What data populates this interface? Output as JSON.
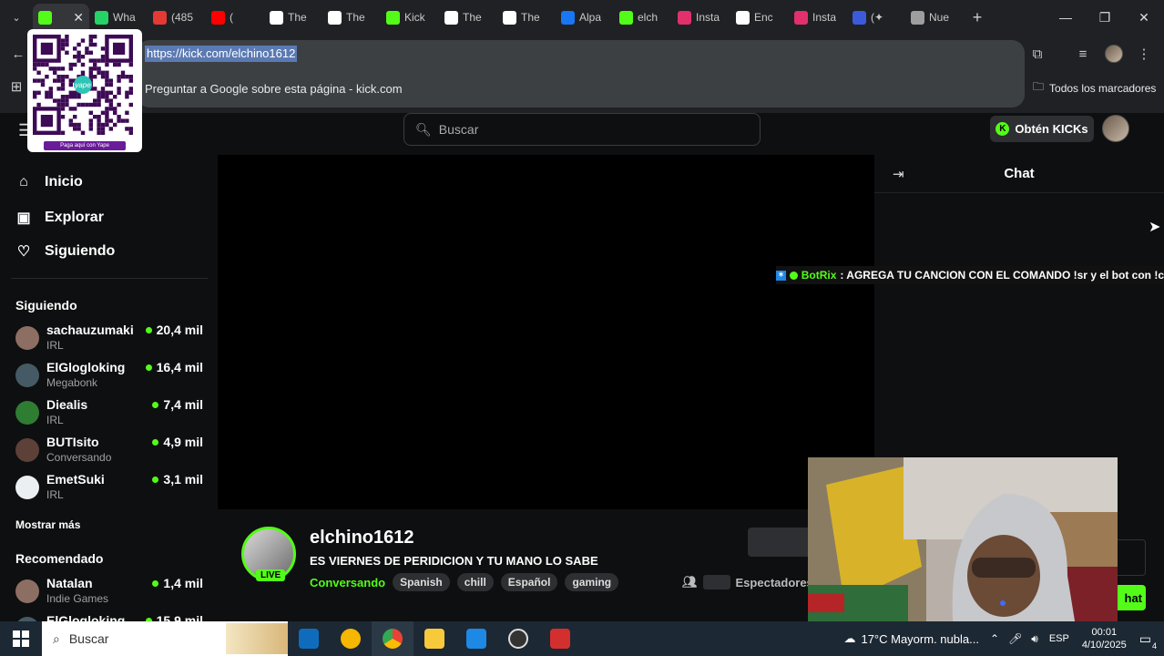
{
  "browser": {
    "tabs": [
      {
        "label": "",
        "icon": "kick-icon",
        "color": "#53fc18",
        "active": true
      },
      {
        "label": "Wha",
        "icon": "whatsapp-icon",
        "color": "#25d366"
      },
      {
        "label": "(485",
        "icon": "app-icon",
        "color": "#e53935"
      },
      {
        "label": "(",
        "icon": "youtube-icon",
        "color": "#ff0000"
      },
      {
        "label": "The",
        "icon": "diamond-icon",
        "color": "#ffffff"
      },
      {
        "label": "The",
        "icon": "diamond-icon",
        "color": "#ffffff"
      },
      {
        "label": "Kick",
        "icon": "kick-icon",
        "color": "#53fc18"
      },
      {
        "label": "The",
        "icon": "diamond-icon",
        "color": "#ffffff"
      },
      {
        "label": "The",
        "icon": "diamond-icon",
        "color": "#ffffff"
      },
      {
        "label": "Alpa",
        "icon": "facebook-icon",
        "color": "#1877f2"
      },
      {
        "label": "elch",
        "icon": "kick-icon",
        "color": "#53fc18"
      },
      {
        "label": "Insta",
        "icon": "instagram-icon",
        "color": "#e1306c"
      },
      {
        "label": "Enc",
        "icon": "tiktok-icon",
        "color": "#ffffff"
      },
      {
        "label": "Insta",
        "icon": "instagram-icon",
        "color": "#e1306c"
      },
      {
        "label": "(✦",
        "icon": "app-icon",
        "color": "#3b5bdb"
      },
      {
        "label": "Nue",
        "icon": "chrome-icon",
        "color": "#9e9e9e"
      }
    ],
    "url": "https://kick.com/elchino1612",
    "suggestion": "Preguntar a Google sobre esta página - kick.com",
    "bookmarks_label": "Todos los marcadores"
  },
  "qr": {
    "label": "Paga aquí con Yape",
    "brand": "yape"
  },
  "kick": {
    "search_placeholder": "Buscar",
    "get_kicks": "Obtén KICKs",
    "brand_color": "#53fc18",
    "nav": [
      {
        "label": "Inicio",
        "icon": "home-icon"
      },
      {
        "label": "Explorar",
        "icon": "explore-icon"
      },
      {
        "label": "Siguiendo",
        "icon": "heart-icon"
      }
    ],
    "following_title": "Siguiendo",
    "following": [
      {
        "name": "sachauzumaki",
        "category": "IRL",
        "viewers": "20,4 mil"
      },
      {
        "name": "ElGlogloking",
        "category": "Megabonk",
        "viewers": "16,4 mil"
      },
      {
        "name": "Diealis",
        "category": "IRL",
        "viewers": "7,4 mil"
      },
      {
        "name": "BUTIsito",
        "category": "Conversando",
        "viewers": "4,9 mil"
      },
      {
        "name": "EmetSuki",
        "category": "IRL",
        "viewers": "3,1 mil"
      }
    ],
    "show_more": "Mostrar más",
    "recommended_title": "Recomendado",
    "recommended": [
      {
        "name": "Natalan",
        "category": "Indie Games",
        "viewers": "1,4 mil"
      },
      {
        "name": "ElGlogloking",
        "category": "",
        "viewers": "15,9 mil"
      }
    ],
    "chat_title": "Chat",
    "chat_message": {
      "user": "BotRix",
      "text": ": AGREGA TU CANCION CON EL COMANDO !sr y el bot con !c"
    },
    "chat_button": "hat",
    "stream": {
      "channel": "elchino1612",
      "live": "LIVE",
      "title": "ES VIERNES DE PERIDICION Y TU MANO LO SABE",
      "category": "Conversando",
      "tags": [
        "Spanish",
        "chill",
        "Español",
        "gaming"
      ],
      "viewers_label": "Espectadores"
    }
  },
  "taskbar": {
    "search": "Buscar",
    "weather": "17°C  Mayorm. nubla...",
    "lang": "ESP",
    "time": "00:01",
    "date": "4/10/2025",
    "notifications": "4"
  }
}
